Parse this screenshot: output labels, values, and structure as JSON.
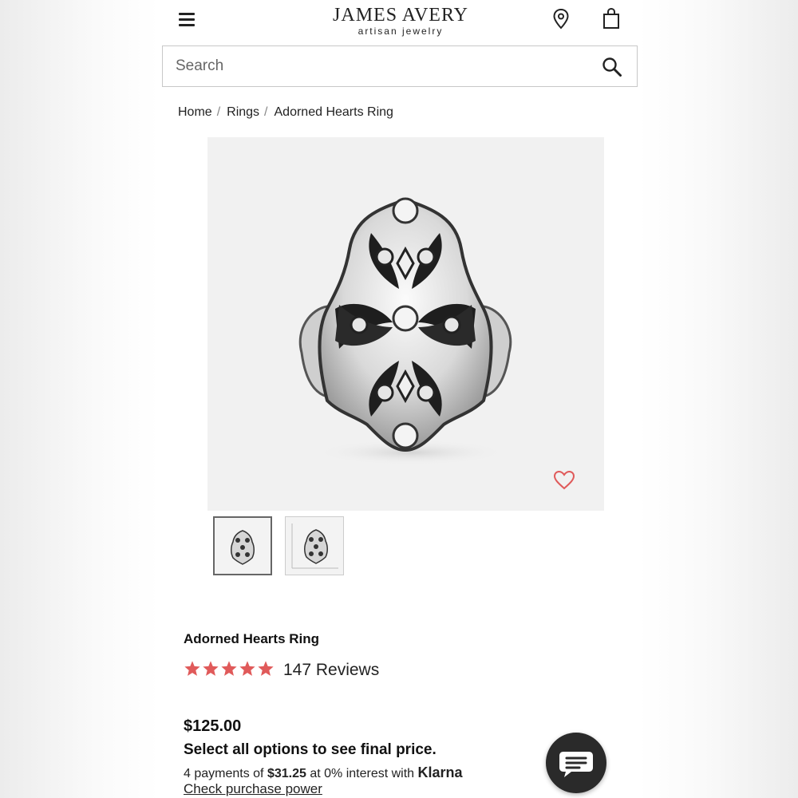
{
  "header": {
    "brand_name": "JAMES AVERY",
    "brand_tagline": "artisan jewelry",
    "icons": [
      "menu-icon",
      "location-pin-icon",
      "shopping-bag-icon"
    ]
  },
  "search": {
    "placeholder": "Search",
    "value": ""
  },
  "breadcrumb": {
    "items": [
      "Home",
      "Rings",
      "Adorned Hearts Ring"
    ],
    "separator": "/"
  },
  "product": {
    "title": "Adorned Hearts Ring",
    "rating": 5,
    "rating_max": 5,
    "reviews_label": "147 Reviews",
    "price": "$125.00",
    "options_note": "Select all options to see final price.",
    "installments": {
      "prefix": "4 payments of ",
      "amount": "$31.25",
      "middle": " at 0% interest with ",
      "provider": "Klarna"
    },
    "check_power_link": "Check purchase power"
  },
  "colors": {
    "star": "#e05a5a",
    "heart": "#e05a5a",
    "chat_bg": "#2a2a2a"
  }
}
